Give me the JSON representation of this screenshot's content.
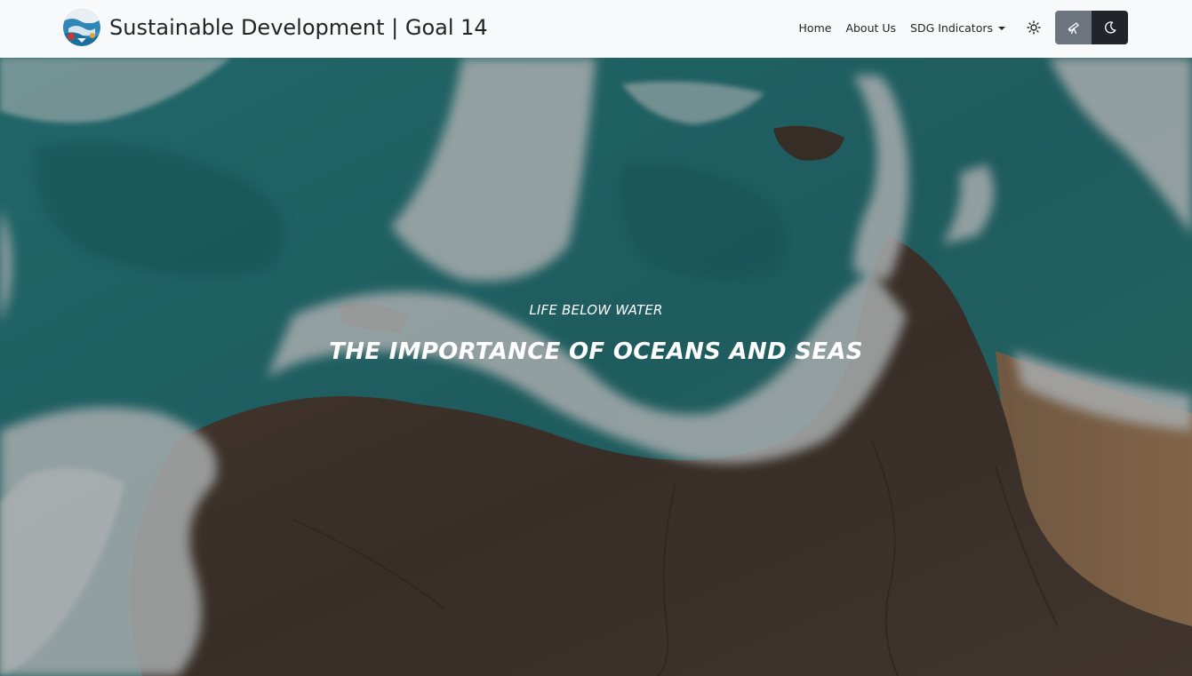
{
  "navbar": {
    "brand_title": "Sustainable Development | Goal 14",
    "logo_icon": "ocean-globe-logo",
    "links": {
      "home": "Home",
      "about": "About Us",
      "indicators": "SDG Indicators"
    },
    "theme_icons": {
      "light": "sun-icon",
      "explore": "telescope-icon",
      "dark": "moon-icon"
    },
    "colors": {
      "background": "#f8f9fa",
      "secondary_button": "#6c757d",
      "dark_button": "#212529"
    }
  },
  "hero": {
    "subtitle": "LIFE BELOW WATER",
    "title": "THE IMPORTANCE OF OCEANS AND SEAS",
    "background_image": "aerial view of ocean waves crashing on rocky coastline"
  }
}
